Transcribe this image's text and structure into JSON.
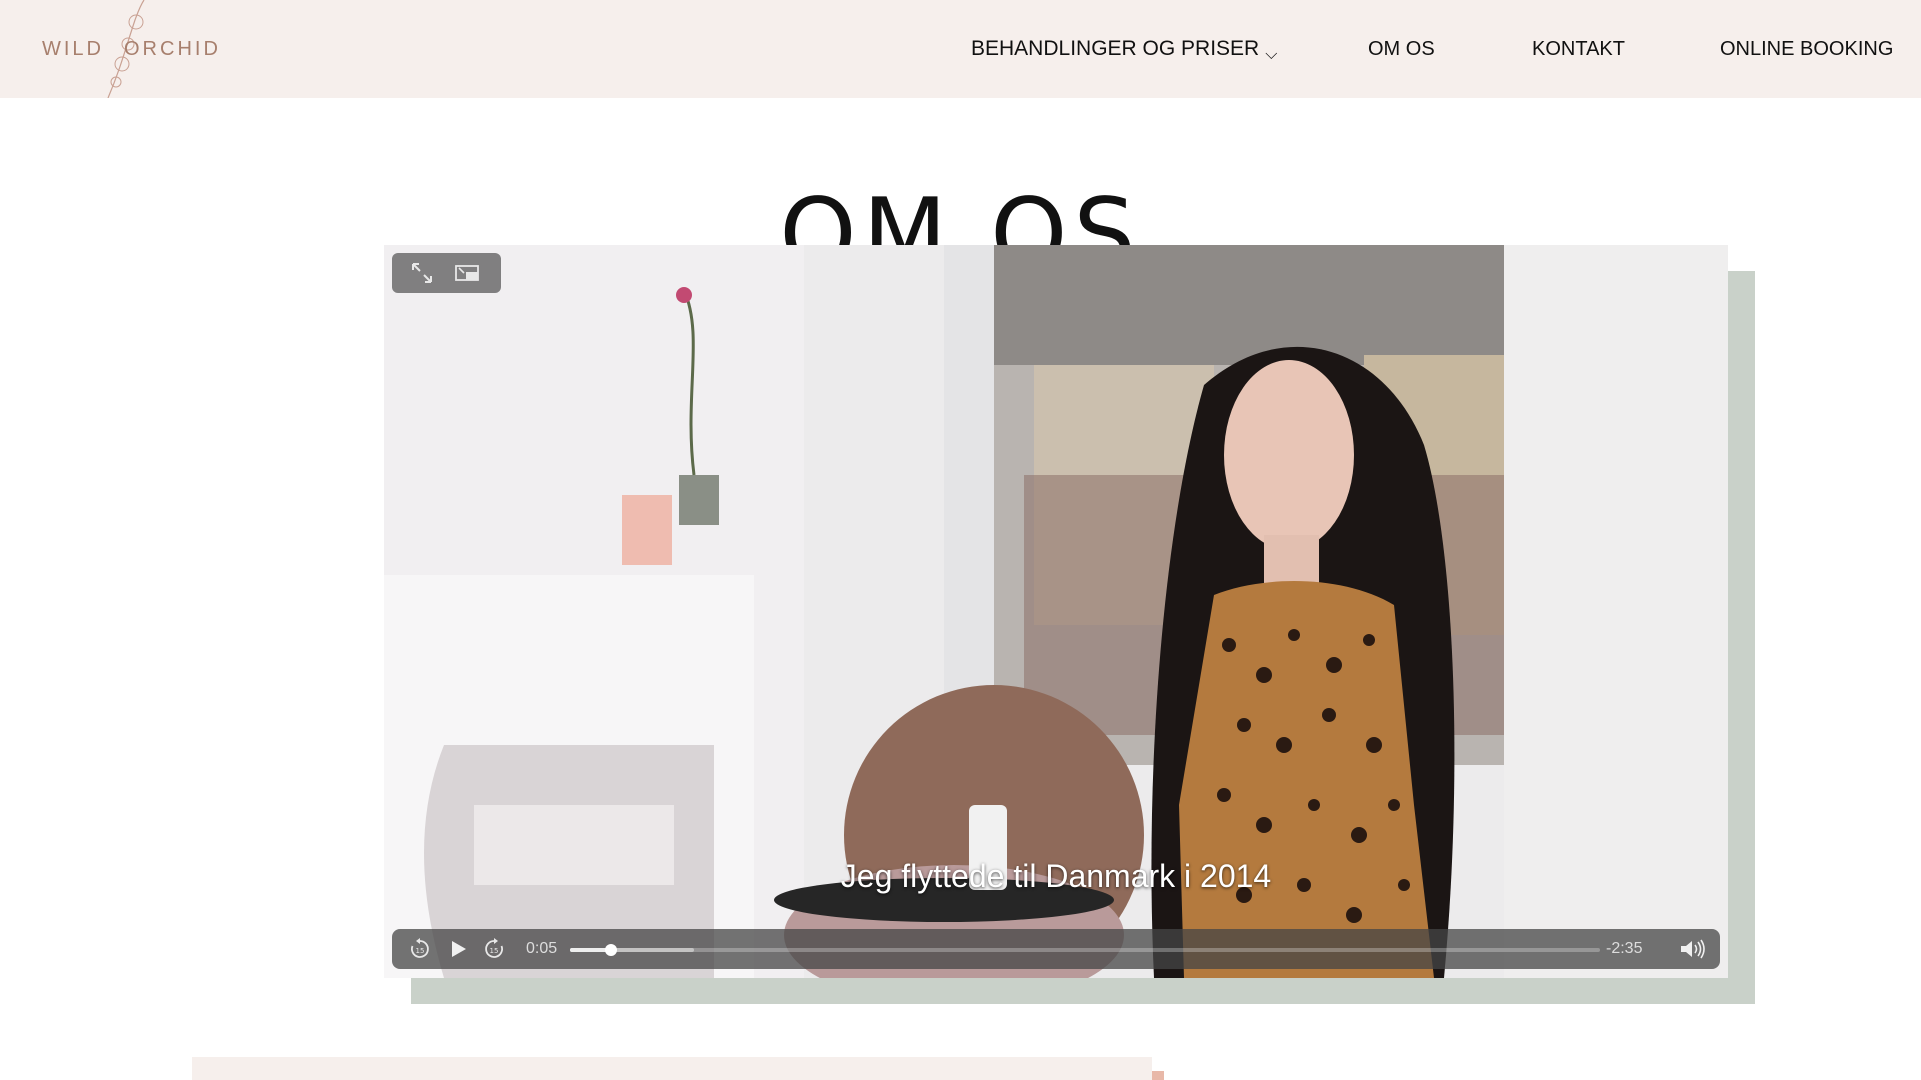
{
  "header": {
    "logo": {
      "left": "WILD",
      "right": "ORCHID"
    },
    "nav": [
      {
        "label": "BEHANDLINGER OG PRISER",
        "has_dropdown": true
      },
      {
        "label": "OM OS"
      },
      {
        "label": "KONTAKT"
      },
      {
        "label": "ONLINE BOOKING"
      }
    ],
    "dropdown_icon": "chevron-down-icon"
  },
  "page": {
    "title": "OM OS"
  },
  "video": {
    "caption": "Jeg flyttede til Danmark i 2014",
    "elapsed": "0:05",
    "remaining": "-2:35",
    "progress_fraction": 0.04,
    "buffered_fraction": 0.12,
    "icons": {
      "fullscreen": "fullscreen-icon",
      "pip": "picture-in-picture-icon",
      "rewind": "skip-back-15-icon",
      "play": "play-icon",
      "forward": "skip-forward-15-icon",
      "volume": "volume-icon"
    }
  },
  "colors": {
    "header_bg": "#f6efec",
    "logo": "#a77f6d",
    "video_shadow": "#c9d1c9",
    "accent_dot": "#e8b8a8"
  }
}
